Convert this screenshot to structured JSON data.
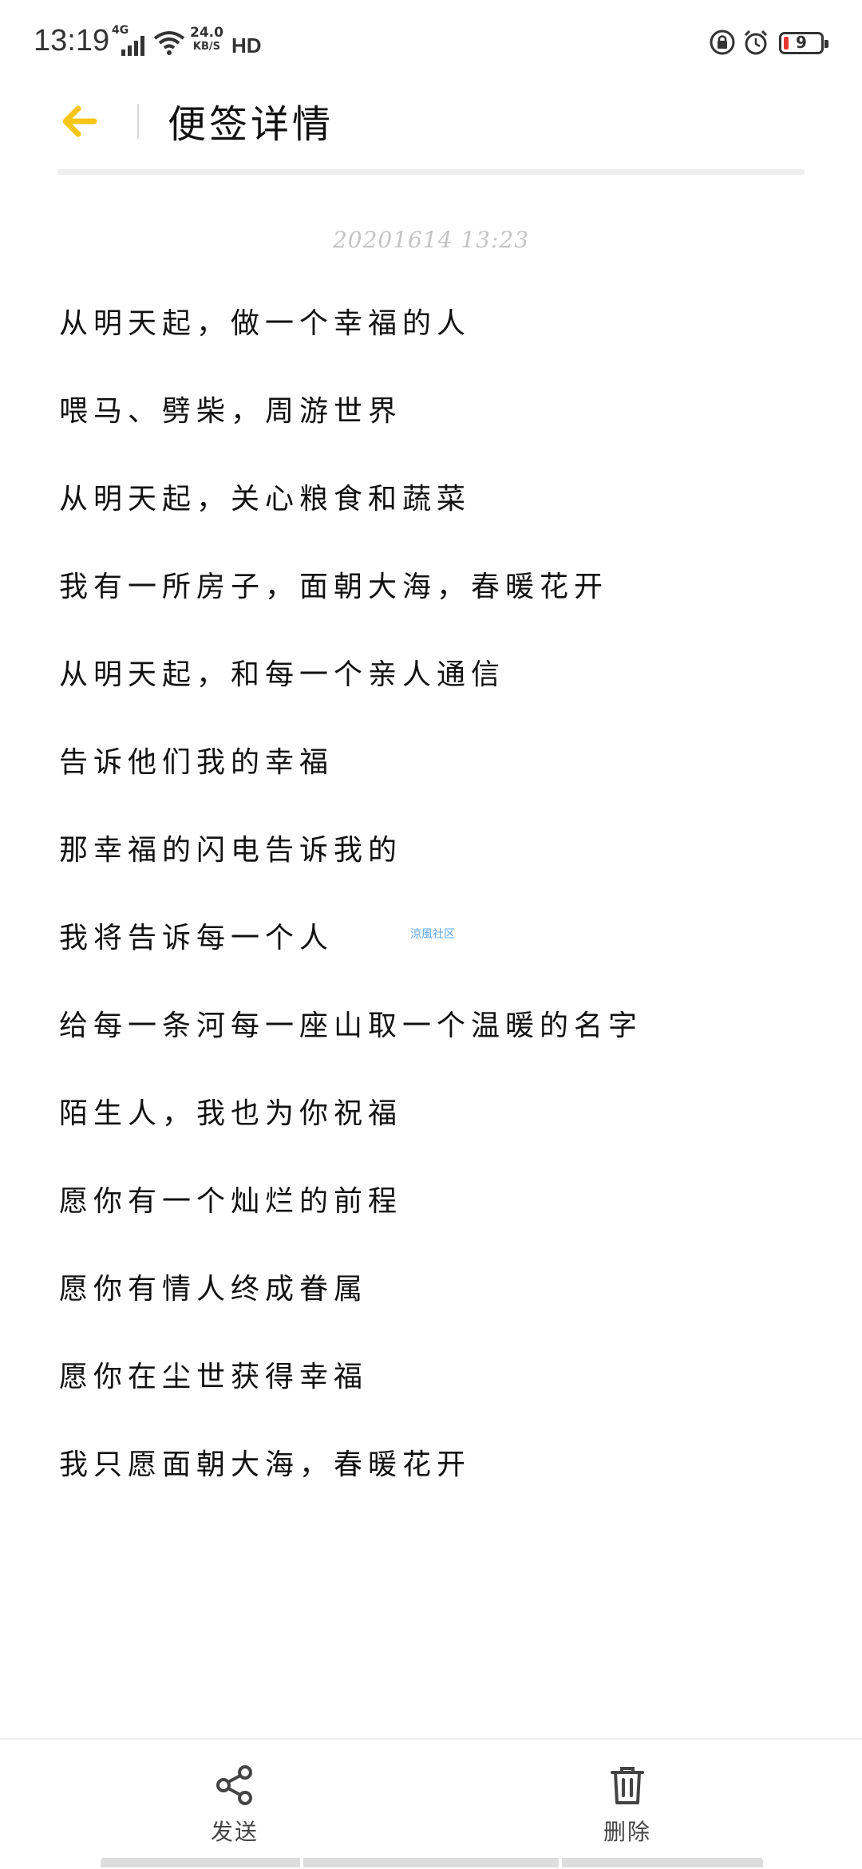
{
  "status_bar": {
    "time": "13:19",
    "network": "4G",
    "speed_value": "24.0",
    "speed_unit": "KB/S",
    "hd": "HD",
    "battery": "9"
  },
  "header": {
    "title": "便签详情",
    "back_icon": "arrow-left-icon",
    "accent_color": "#F5C518"
  },
  "note": {
    "date": "20201614  13:23",
    "lines": [
      "从明天起，做一个幸福的人",
      "喂马、劈柴，周游世界",
      "从明天起，关心粮食和蔬菜",
      "我有一所房子，面朝大海，春暖花开",
      "从明天起，和每一个亲人通信",
      "告诉他们我的幸福",
      "那幸福的闪电告诉我的",
      "我将告诉每一个人",
      "给每一条河每一座山取一个温暖的名字",
      "陌生人，我也为你祝福",
      "愿你有一个灿烂的前程",
      "愿你有情人终成眷属",
      "愿你在尘世获得幸福",
      "我只愿面朝大海，春暖花开"
    ],
    "watermark": "涼風社区"
  },
  "bottom_bar": {
    "send_label": "发送",
    "delete_label": "删除",
    "send_icon": "share-icon",
    "delete_icon": "trash-icon"
  }
}
